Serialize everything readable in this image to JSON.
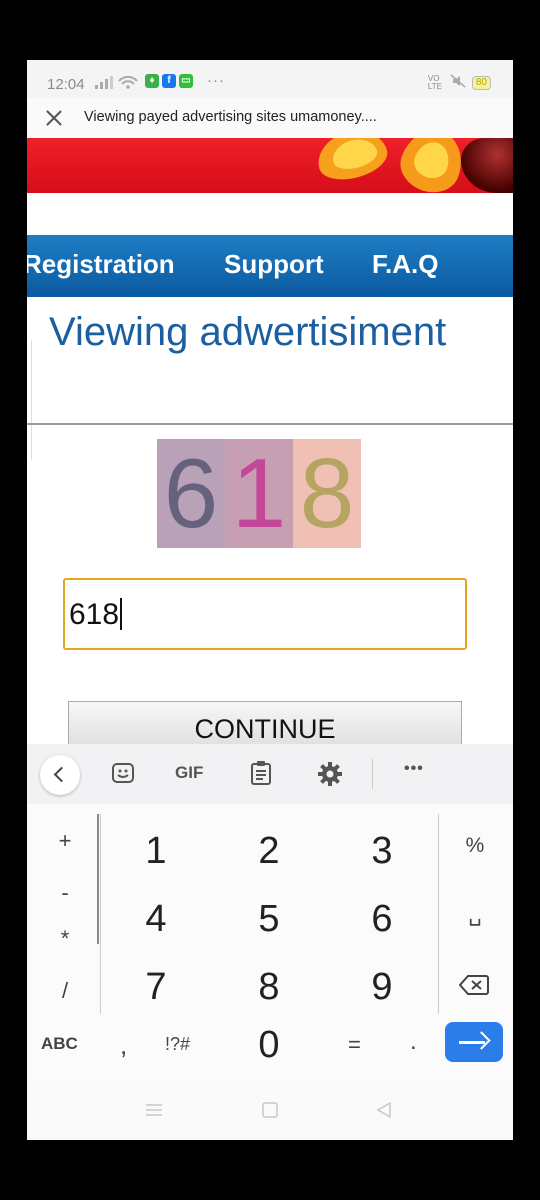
{
  "status_bar": {
    "time": "12:04",
    "network": "VO LTE",
    "battery": "80",
    "more": "···",
    "app_icons": [
      {
        "name": "notification-app-icon",
        "glyph": "♦",
        "color": "#3ab24a"
      },
      {
        "name": "facebook-icon",
        "glyph": "f",
        "color": "#1877f2"
      },
      {
        "name": "chat-bubble-icon",
        "glyph": "▭",
        "color": "#2fbf3a"
      }
    ]
  },
  "browser": {
    "title": "Viewing payed advertising sites umamoney...."
  },
  "nav": {
    "items": [
      "Registration",
      "Support",
      "F.A.Q"
    ]
  },
  "page": {
    "heading": "Viewing adwertisiment",
    "captcha": [
      {
        "digit": "6",
        "bg": "#b9a1b8",
        "color": "#66627e"
      },
      {
        "digit": "1",
        "bg": "#c6a0b2",
        "color": "#c3489a"
      },
      {
        "digit": "8",
        "bg": "#f0c0b4",
        "color": "#b5a462"
      }
    ],
    "input_value": "618",
    "continue_label": "CONTINUE"
  },
  "keyboard": {
    "toolbar": {
      "gif": "GIF",
      "more": "•••"
    },
    "left_symbols": [
      "+",
      "-",
      "*",
      "/"
    ],
    "rows": [
      [
        "1",
        "2",
        "3"
      ],
      [
        "4",
        "5",
        "6"
      ],
      [
        "7",
        "8",
        "9"
      ]
    ],
    "right_symbols": [
      "%",
      "␣"
    ],
    "bottom": {
      "abc": "ABC",
      "comma": ",",
      "symbols": "!?#",
      "zero": "0",
      "equals": "=",
      "dot": "."
    }
  },
  "colors": {
    "nav_blue": "#0a5aa0",
    "heading_blue": "#1b5fa0",
    "input_border": "#e3a61c",
    "enter_key": "#2b7de9"
  }
}
